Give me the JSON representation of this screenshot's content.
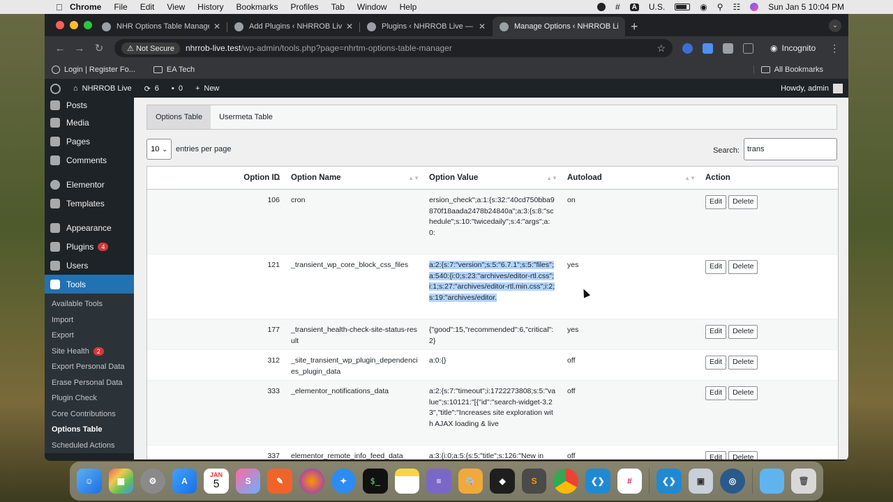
{
  "menubar": {
    "app": "Chrome",
    "items": [
      "File",
      "Edit",
      "View",
      "History",
      "Bookmarks",
      "Profiles",
      "Tab",
      "Window",
      "Help"
    ],
    "input_source": "U.S.",
    "datetime": "Sun Jan 5  10:04 PM"
  },
  "browser": {
    "tabs": [
      {
        "title": "NHR Options Table Manager",
        "active": false
      },
      {
        "title": "Add Plugins ‹ NHRROB Live —",
        "active": false
      },
      {
        "title": "Plugins ‹ NHRROB Live — Wo",
        "active": false
      },
      {
        "title": "Manage Options ‹ NHRROB Li",
        "active": true
      }
    ],
    "security": "Not Secure",
    "url_host": "nhrrob-live.test",
    "url_path": "/wp-admin/tools.php?page=nhrtm-options-table-manager",
    "profile": "Incognito",
    "bookmarks": [
      "Login | Register Fo...",
      "EA Tech"
    ],
    "all_bookmarks": "All Bookmarks"
  },
  "adminbar": {
    "site_name": "NHRROB Live",
    "updates": "6",
    "comments": "0",
    "new_label": "New",
    "greeting": "Howdy, admin"
  },
  "sidebar": {
    "items": [
      {
        "label": "Posts",
        "badge": ""
      },
      {
        "label": "Media",
        "badge": ""
      },
      {
        "label": "Pages",
        "badge": ""
      },
      {
        "label": "Comments",
        "badge": ""
      },
      {
        "label": "Elementor",
        "badge": ""
      },
      {
        "label": "Templates",
        "badge": ""
      },
      {
        "label": "Appearance",
        "badge": ""
      },
      {
        "label": "Plugins",
        "badge": "4"
      },
      {
        "label": "Users",
        "badge": ""
      },
      {
        "label": "Tools",
        "badge": ""
      }
    ],
    "submenu": [
      {
        "label": "Available Tools",
        "badge": ""
      },
      {
        "label": "Import",
        "badge": ""
      },
      {
        "label": "Export",
        "badge": ""
      },
      {
        "label": "Site Health",
        "badge": "2"
      },
      {
        "label": "Export Personal Data",
        "badge": ""
      },
      {
        "label": "Erase Personal Data",
        "badge": ""
      },
      {
        "label": "Plugin Check",
        "badge": ""
      },
      {
        "label": "Core Contributions",
        "badge": ""
      },
      {
        "label": "Options Table",
        "badge": ""
      },
      {
        "label": "Scheduled Actions",
        "badge": ""
      }
    ]
  },
  "page": {
    "tabs": [
      "Options Table",
      "Usermeta Table"
    ],
    "entries_value": "10",
    "entries_label": "entries per page",
    "search_label": "Search:",
    "search_value": "trans",
    "columns": [
      "Option ID",
      "Option Name",
      "Option Value",
      "Autoload",
      "Action"
    ],
    "edit_label": "Edit",
    "delete_label": "Delete",
    "rows": [
      {
        "id": "106",
        "name": "cron",
        "value": "ersion_check\";a:1:{s:32:\"40cd750bba9870f18aada2478b24840a\";a:3:{s:8:\"schedule\";s:10:\"twicedaily\";s:4:\"args\";a:0:",
        "autoload": "on"
      },
      {
        "id": "121",
        "name": "_transient_wp_core_block_css_files",
        "value": "a:2:{s:7:\"version\";s:5:\"6.7.1\";s:5:\"files\";a:540:{i:0;s:23:\"archives/editor-rtl.css\";i:1;s:27:\"archives/editor-rtl.min.css\";i:2;s:19:\"archives/editor.",
        "autoload": "yes"
      },
      {
        "id": "177",
        "name": "_transient_health-check-site-status-result",
        "value": "{\"good\":15,\"recommended\":6,\"critical\":2}",
        "autoload": "yes"
      },
      {
        "id": "312",
        "name": "_site_transient_wp_plugin_dependencies_plugin_data",
        "value": "a:0:{}",
        "autoload": "off"
      },
      {
        "id": "333",
        "name": "_elementor_notifications_data",
        "value": "a:2:{s:7:\"timeout\";i:1722273808;s:5:\"value\";s:10121:\"[{\"id\":\"search-widget-3.23\",\"title\":\"Increases site exploration with AJAX loading & live",
        "autoload": "off"
      },
      {
        "id": "337",
        "name": "elementor_remote_info_feed_data",
        "value": "a:3:{i:0;a:5:{s:5:\"title\";s:126:\"New in",
        "autoload": "off"
      }
    ]
  },
  "dock": {
    "calendar_month": "JAN",
    "calendar_day": "5"
  },
  "colors": {
    "wp_dark": "#1d2327",
    "wp_blue": "#2271b1",
    "selection": "#b4d5fe",
    "badge_red": "#d63638"
  }
}
